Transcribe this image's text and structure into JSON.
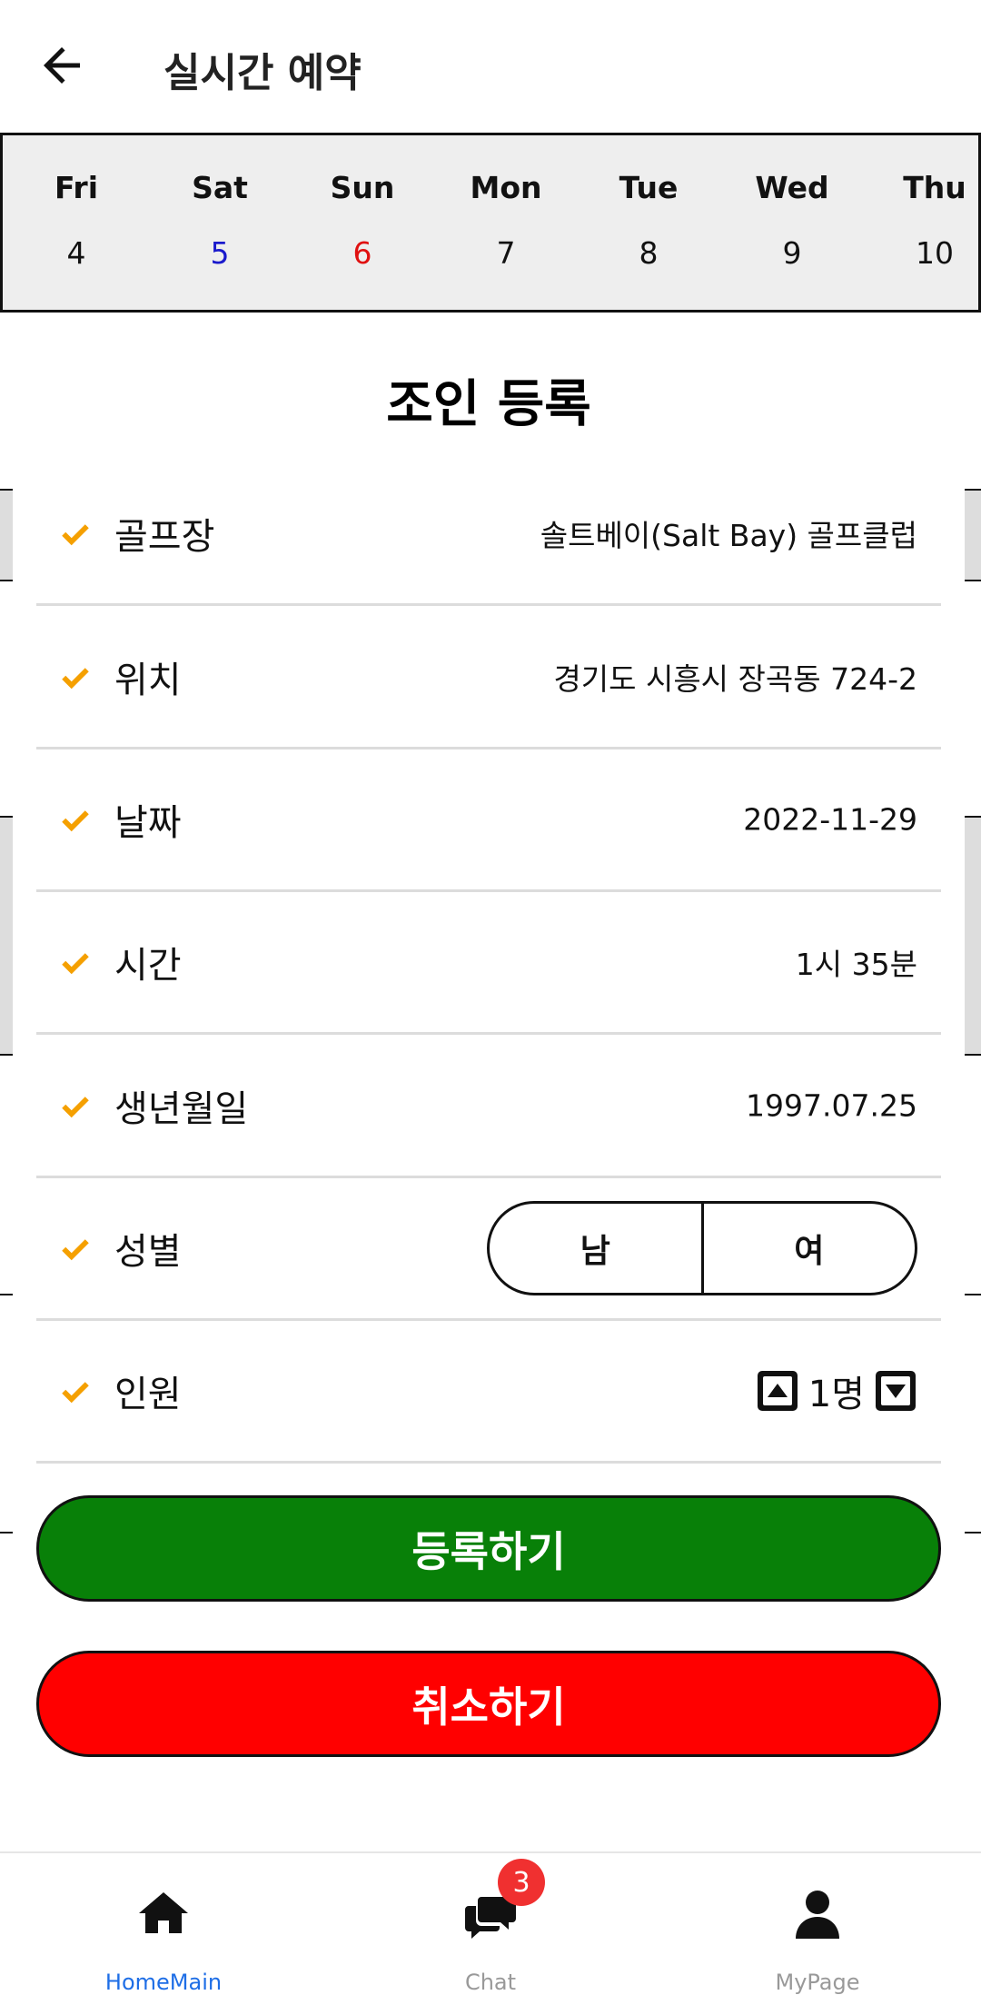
{
  "header": {
    "title": "실시간 예약"
  },
  "date_strip": {
    "days": [
      {
        "name": "Fri",
        "num": "4"
      },
      {
        "name": "Sat",
        "num": "5"
      },
      {
        "name": "Sun",
        "num": "6"
      },
      {
        "name": "Mon",
        "num": "7"
      },
      {
        "name": "Tue",
        "num": "8"
      },
      {
        "name": "Wed",
        "num": "9"
      },
      {
        "name": "Thu",
        "num": "10"
      }
    ]
  },
  "sheet": {
    "title": "조인 등록",
    "fields": {
      "course": {
        "label": "골프장",
        "value": "솔트베이(Salt Bay) 골프클럽"
      },
      "location": {
        "label": "위치",
        "value": "경기도 시흥시 장곡동 724-2"
      },
      "date": {
        "label": "날짜",
        "value": "2022-11-29"
      },
      "time": {
        "label": "시간",
        "value": "1시 35분"
      },
      "birth": {
        "label": "생년월일",
        "value": "1997.07.25"
      },
      "gender": {
        "label": "성별",
        "male": "남",
        "female": "여"
      },
      "people": {
        "label": "인원",
        "count": "1명"
      }
    },
    "register_label": "등록하기",
    "cancel_label": "취소하기"
  },
  "nav": {
    "home": "HomeMain",
    "chat": "Chat",
    "chat_badge": "3",
    "mypage": "MyPage"
  },
  "colors": {
    "check": "#f5a000",
    "register": "#088008",
    "cancel": "#ff0000",
    "nav_active": "#1e6ee6",
    "badge": "#f03030"
  }
}
